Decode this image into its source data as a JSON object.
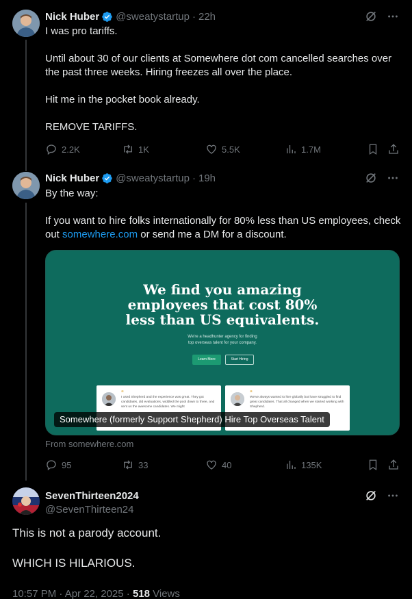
{
  "tweets": [
    {
      "author": {
        "name": "Nick Huber",
        "handle": "@sweatystartup",
        "verified": true
      },
      "time": "22h",
      "paragraphs": [
        "I was pro tariffs.",
        "Until about 30 of our clients at Somewhere dot com cancelled searches over the past three weeks. Hiring freezes all over the place.",
        "Hit me in the pocket book already.",
        "REMOVE TARIFFS."
      ],
      "stats": {
        "replies": "2.2K",
        "reposts": "1K",
        "likes": "5.5K",
        "views": "1.7M"
      }
    },
    {
      "author": {
        "name": "Nick Huber",
        "handle": "@sweatystartup",
        "verified": true
      },
      "time": "19h",
      "line1": "By the way:",
      "line2_before": "If you want to hire folks internationally for 80% less than US employees, check out ",
      "link": "somewhere.com",
      "line2_after": " or send me a DM for a discount.",
      "card": {
        "headline_l1": "We find you amazing",
        "headline_l2": "employees that cost 80%",
        "headline_l3": "less than US equivalents.",
        "sub_l1": "We're a headhunter agency for finding",
        "sub_l2": "top overseas talent for your company.",
        "button_primary": "Learn More",
        "button_secondary": "Start Hiring",
        "testimonial_1": "I used Shepherd and the experience was great. They got candidates, did evaluations, widdled the pool down to three, and sent us the awesome candidates. We might",
        "testimonial_2": "We've always wanted to hire globally but have struggled to find great candidates. That all changed when we started working with Shepherd.",
        "quote_mark": "“",
        "caption": "Somewhere (formerly Support Shepherd) Hire Top Overseas Talent"
      },
      "from": "From somewhere.com",
      "stats": {
        "replies": "95",
        "reposts": "33",
        "likes": "40",
        "views": "135K"
      }
    },
    {
      "author": {
        "name": "SevenThirteen2024",
        "handle": "@SevenThirteen24"
      },
      "paragraphs": [
        "This is not a parody account.",
        "WHICH IS HILARIOUS."
      ],
      "timestamp": "10:57 PM · Apr 22, 2025 · ",
      "views_count": "518",
      "views_label": " Views"
    }
  ],
  "colors": {
    "background": "#000000",
    "text": "#e7e9ea",
    "muted": "#71767b",
    "link": "#1d9bf0",
    "verified": "#1d9bf0",
    "card": "#0e6b5d"
  }
}
